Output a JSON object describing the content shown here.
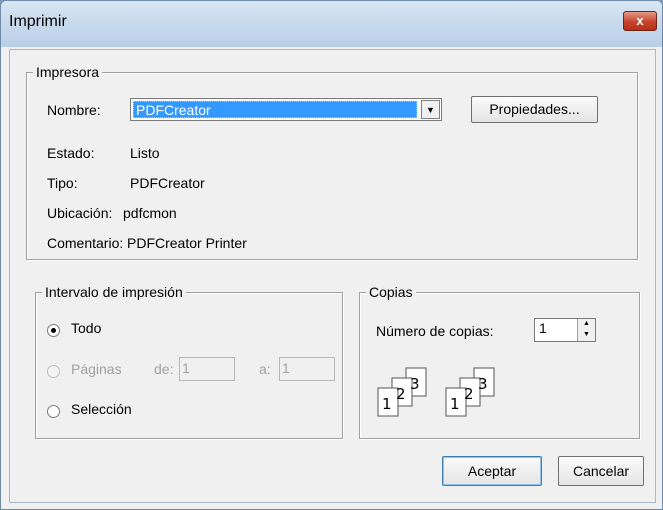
{
  "window": {
    "title": "Imprimir",
    "close_label": "x"
  },
  "printer": {
    "legend": "Impresora",
    "name_label": "Nombre:",
    "name_value": "PDFCreator",
    "properties_label": "Propiedades...",
    "status_label": "Estado:",
    "status_value": "Listo",
    "type_label": "Tipo:",
    "type_value": "PDFCreator",
    "location_label": "Ubicación:",
    "location_value": "pdfcmon",
    "comment_label": "Comentario:",
    "comment_value": "PDFCreator Printer"
  },
  "range": {
    "legend": "Intervalo de impresión",
    "all_label": "Todo",
    "pages_label": "Páginas",
    "from_label": "de:",
    "from_value": "1",
    "to_label": "a:",
    "to_value": "1",
    "selection_label": "Selección",
    "selected": "all"
  },
  "copies": {
    "legend": "Copias",
    "count_label": "Número de copias:",
    "count_value": "1",
    "collate_icon": "collate-icon",
    "pages": [
      "1",
      "2",
      "3"
    ]
  },
  "buttons": {
    "ok_label": "Aceptar",
    "cancel_label": "Cancelar"
  }
}
